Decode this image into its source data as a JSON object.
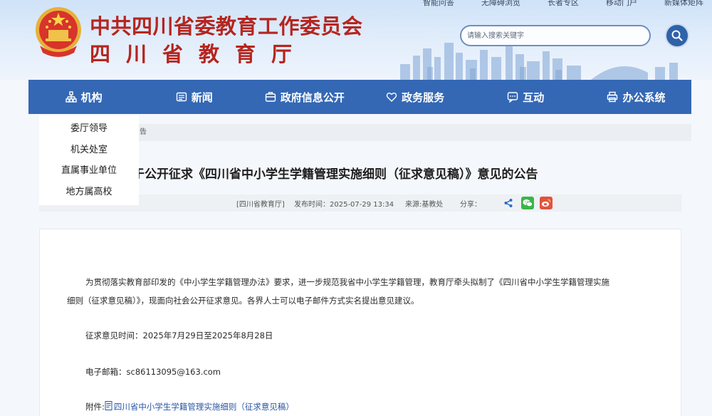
{
  "header": {
    "title_main": "中共四川省委教育工作委员会",
    "title_sub": "四川省教育厅",
    "toplinks": [
      "智能问答",
      "无障碍浏览",
      "长者专区",
      "移动门户",
      "新媒体矩阵"
    ],
    "search_placeholder": "请输入搜索关键字"
  },
  "nav": {
    "items": [
      {
        "label": "机构",
        "icon": "org-icon"
      },
      {
        "label": "新闻",
        "icon": "news-icon"
      },
      {
        "label": "政府信息公开",
        "icon": "info-open-icon"
      },
      {
        "label": "政务服务",
        "icon": "service-icon"
      },
      {
        "label": "互动",
        "icon": "interact-icon"
      },
      {
        "label": "办公系统",
        "icon": "office-icon"
      }
    ]
  },
  "dropdown": {
    "items": [
      "委厅领导",
      "机关处室",
      "直属事业单位",
      "地方属高校"
    ]
  },
  "breadcrumb": {
    "tail": "告"
  },
  "article": {
    "title": "于公开征求《四川省中小学生学籍管理实施细则（征求意见稿）》意见的公告",
    "meta": {
      "source": "[四川省教育厅]",
      "time": "发布时间：2025-07-29 13:34",
      "from": "来源:基教处",
      "share_label": "分享："
    },
    "paragraphs": {
      "p1_line1": "为贯彻落实教育部印发的《中小学生学籍管理办法》要求，进一步规范我省中小学生学籍管理，教育厅牵头拟制了《四川省中小学生学籍管理实施",
      "p1_line2": "细则（征求意见稿）》，现面向社会公开征求意见。各界人士可以电子邮件方式实名提出意见建议。",
      "period": "征求意见时间：2025年7月29日至2025年8月28日",
      "email": "电子邮箱：sc86113095@163.com",
      "attachment_label": "附件:",
      "attachment_link": "四川省中小学生学籍管理实施细则（征求意见稿）"
    }
  },
  "colors": {
    "title_red": "#b5251f",
    "nav_blue": "#3468b5",
    "wechat_green": "#3bb54a",
    "weibo_red": "#e2533f",
    "share_blue": "#2d6cc0"
  }
}
